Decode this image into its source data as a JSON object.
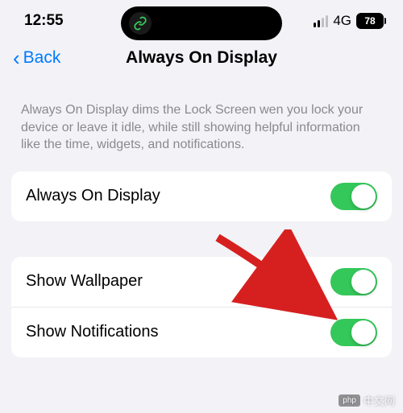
{
  "status": {
    "time": "12:55",
    "network": "4G",
    "battery": "78"
  },
  "nav": {
    "back": "Back",
    "title": "Always On Display"
  },
  "description": "Always On Display dims the Lock Screen wen you lock your device or leave it idle, while still showing helpful information like the time, widgets, and notifications.",
  "rows": {
    "aod": "Always On Display",
    "wallpaper": "Show Wallpaper",
    "notifications": "Show Notifications"
  },
  "toggles": {
    "aod": true,
    "wallpaper": true,
    "notifications": true
  },
  "watermark": {
    "badge": "php",
    "text": "中文网"
  },
  "colors": {
    "accent": "#007aff",
    "switch_on": "#34c759"
  }
}
